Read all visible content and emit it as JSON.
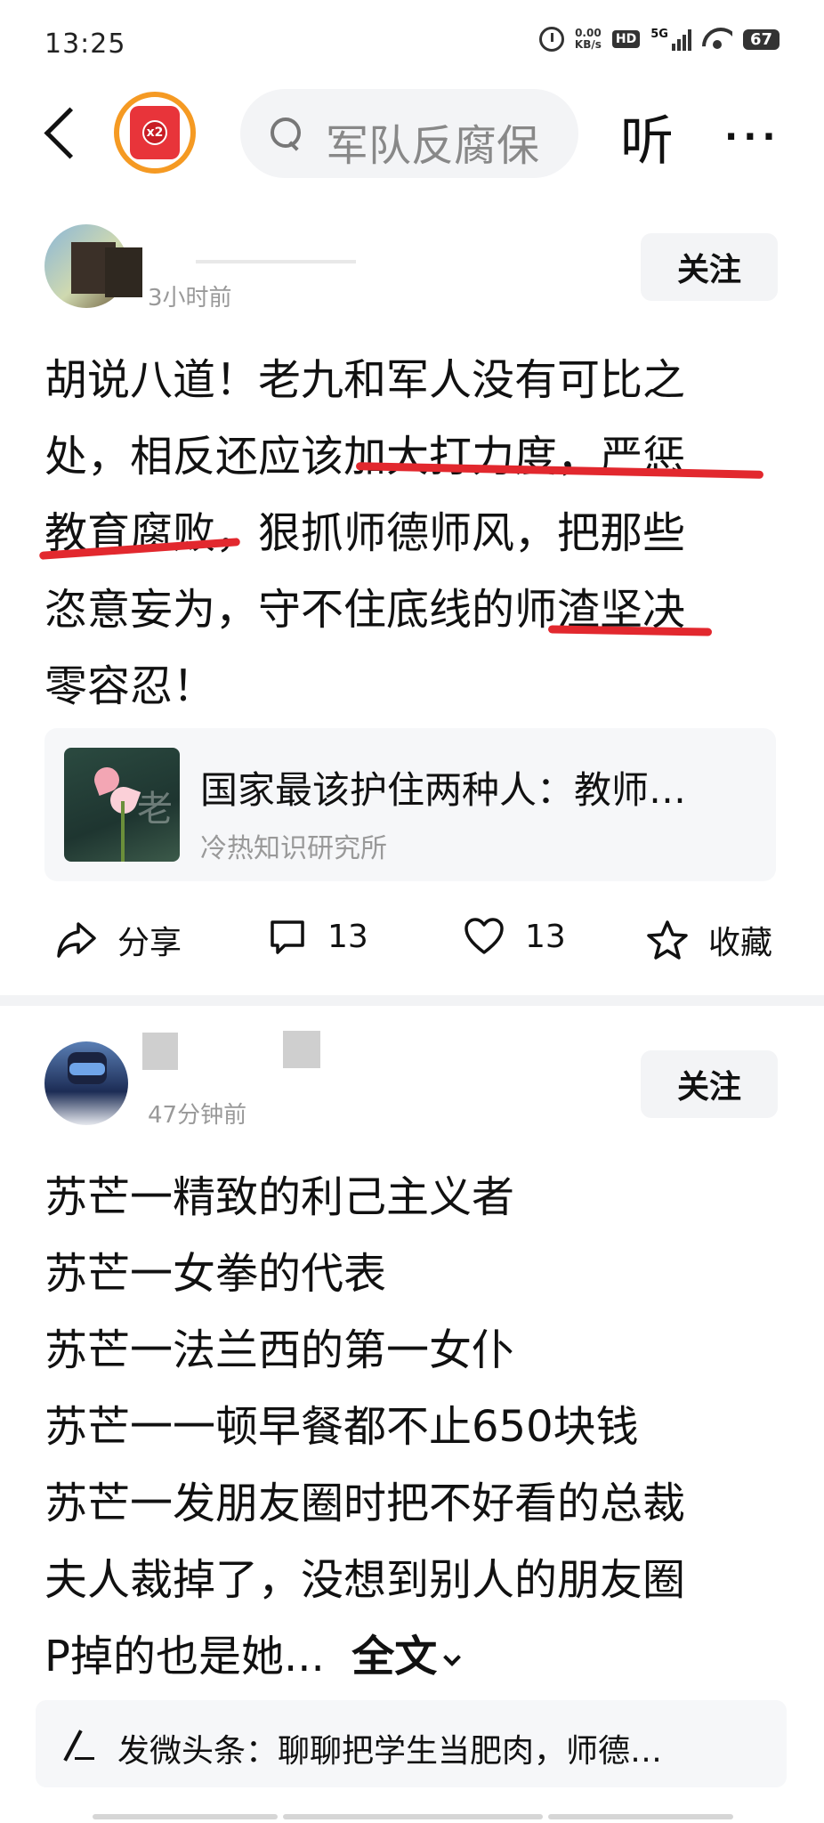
{
  "status_bar": {
    "time": "13:25",
    "net_speed_value": "0.00",
    "net_speed_unit": "KB/s",
    "hd_label": "HD",
    "signal_label": "5G",
    "battery": "67"
  },
  "top_bar": {
    "reward_badge": "x2",
    "search_text": "军队反腐保",
    "listen_label": "听",
    "more_label": "···"
  },
  "posts": [
    {
      "time": "3小时前",
      "follow_label": "关注",
      "lines": [
        "胡说八道！老九和军人没有可比之",
        "处，相反还应该加大打力度，严惩",
        "教育腐败，狠抓师德师风，把那些",
        "恣意妄为，守不住底线的师渣坚决",
        "零容忍！"
      ],
      "link_card": {
        "title": "国家最该护住两种人：教师…",
        "source": "冷热知识研究所",
        "thumb_text": "老"
      },
      "actions": {
        "share_label": "分享",
        "comment_count": "13",
        "like_count": "13",
        "collect_label": "收藏"
      }
    },
    {
      "time": "47分钟前",
      "follow_label": "关注",
      "lines": [
        "苏芒一精致的利己主义者",
        "苏芒一女拳的代表",
        "苏芒一法兰西的第一女仆",
        "苏芒一一顿早餐都不止650块钱",
        "苏芒一发朋友圈时把不好看的总裁",
        "夫人裁掉了，没想到别人的朋友圈",
        "P掉的也是她..."
      ],
      "read_more": "全文"
    }
  ],
  "bottom_bar": {
    "text": "发微头条：聊聊把学生当肥肉，师德…"
  },
  "colors": {
    "underline_red": "#e2282e",
    "reward_orange": "#f59a23",
    "reward_red": "#e8343a",
    "muted_text": "#999999"
  }
}
